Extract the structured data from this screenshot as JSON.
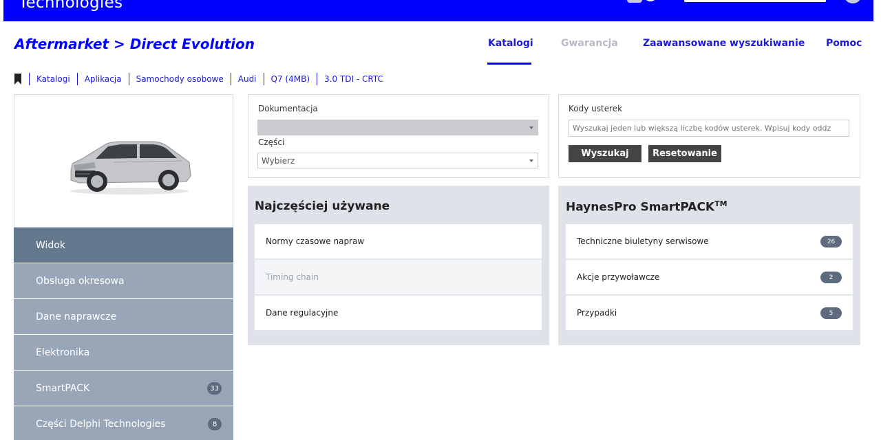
{
  "header": {
    "logo_text": "Technologies",
    "brand_color": "#0000ff"
  },
  "page": {
    "title": "Aftermarket > Direct Evolution"
  },
  "nav": {
    "tabs": [
      {
        "label": "Katalogi",
        "active": true
      },
      {
        "label": "Gwarancja",
        "disabled": true
      },
      {
        "label": "Zaawansowane wyszukiwanie"
      },
      {
        "label": "Pomoc"
      }
    ]
  },
  "breadcrumb": {
    "icon": "bookmark-icon",
    "items": [
      "Katalogi",
      "Aplikacja",
      "Samochody osobowe",
      "Audi",
      "Q7 (4MB)",
      "3.0 TDI - CRTC"
    ]
  },
  "sidebar": {
    "items": [
      {
        "label": "Widok",
        "active": true
      },
      {
        "label": "Obsługa okresowa"
      },
      {
        "label": "Dane naprawcze"
      },
      {
        "label": "Elektronika"
      },
      {
        "label": "SmartPACK",
        "badge": "33"
      },
      {
        "label": "Części Delphi Technologies",
        "badge": "8"
      }
    ]
  },
  "docs": {
    "documentation_label": "Dokumentacja",
    "parts_label": "Części",
    "parts_value": "Wybierz"
  },
  "fault_codes": {
    "label": "Kody usterek",
    "placeholder": "Wyszukaj jeden lub większą liczbę kodów usterek. Wpisuj kody oddz",
    "search_button": "Wyszukaj",
    "reset_button": "Resetowanie"
  },
  "most_used": {
    "title": "Najczęściej używane",
    "items": [
      "Normy czasowe napraw",
      "Timing chain",
      "Dane regulacyjne"
    ]
  },
  "smartpack": {
    "title": "HaynesPro SmartPACK",
    "title_sup": "TM",
    "items": [
      {
        "label": "Techniczne biuletyny serwisowe",
        "count": "26"
      },
      {
        "label": "Akcje przywoławcze",
        "count": "2"
      },
      {
        "label": "Przypadki",
        "count": "5"
      }
    ]
  }
}
